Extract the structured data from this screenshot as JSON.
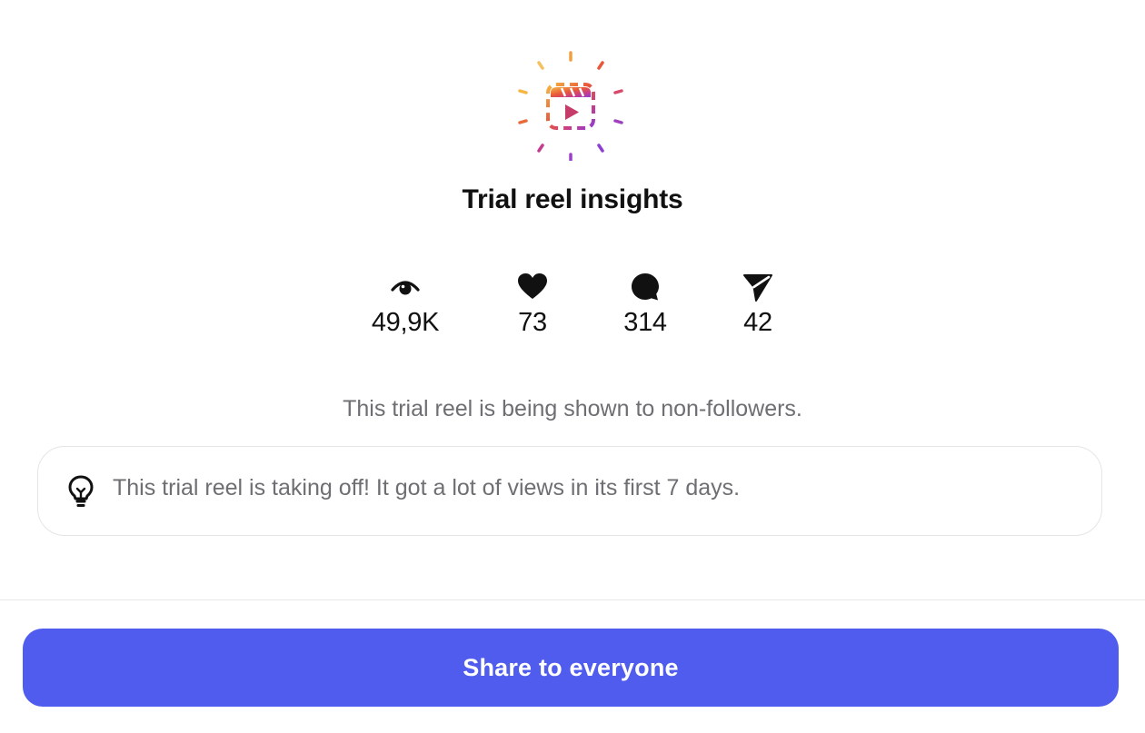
{
  "title": "Trial reel insights",
  "stats": [
    {
      "icon": "eye-icon",
      "value": "49,9K"
    },
    {
      "icon": "heart-icon",
      "value": "73"
    },
    {
      "icon": "comment-icon",
      "value": "314"
    },
    {
      "icon": "send-icon",
      "value": "42"
    }
  ],
  "audience_note": "This trial reel is being shown to non-followers.",
  "tip": {
    "icon": "lightbulb-icon",
    "text": "This trial reel is taking off! It got a lot of views in its first 7 days."
  },
  "share_button": {
    "label": "Share to everyone"
  },
  "colors": {
    "accent": "#4f5ced",
    "muted_text": "#6e6e73",
    "gradient": [
      "#f5b642",
      "#e8573a",
      "#c53c8f",
      "#8e3fd1"
    ]
  }
}
